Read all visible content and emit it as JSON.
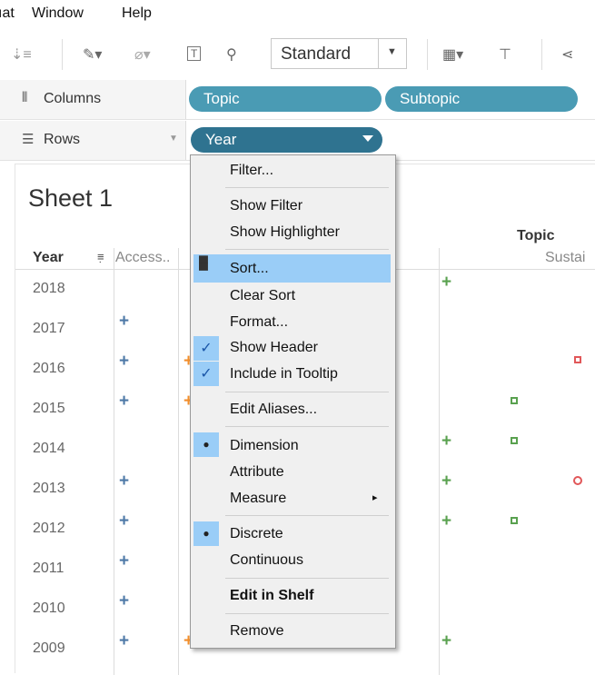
{
  "menubar": {
    "items": [
      "ıat",
      "Window",
      "Help"
    ]
  },
  "toolbar": {
    "view_mode": "Standard"
  },
  "shelves": {
    "columns": {
      "label": "Columns",
      "pills": [
        "Topic",
        "Subtopic"
      ]
    },
    "rows": {
      "label": "Rows",
      "pills": [
        "Year"
      ]
    }
  },
  "sheet": {
    "title": "Sheet 1",
    "row_header": "Year",
    "col_header_1": "Access..",
    "topic_header": "Topic",
    "topic_sub": "Sustai",
    "years": [
      "2018",
      "2017",
      "2016",
      "2015",
      "2014",
      "2013",
      "2012",
      "2011",
      "2010",
      "2009"
    ]
  },
  "context_menu": {
    "items": {
      "filter": "Filter...",
      "show_filter": "Show Filter",
      "show_highlighter": "Show Highlighter",
      "sort": "Sort...",
      "clear_sort": "Clear Sort",
      "format": "Format...",
      "show_header": "Show Header",
      "include_tooltip": "Include in Tooltip",
      "edit_aliases": "Edit Aliases...",
      "dimension": "Dimension",
      "attribute": "Attribute",
      "measure": "Measure",
      "discrete": "Discrete",
      "continuous": "Continuous",
      "edit_in_shelf": "Edit in Shelf",
      "remove": "Remove"
    },
    "checked": [
      "Show Header",
      "Include in Tooltip"
    ],
    "selected_radio": [
      "Dimension",
      "Discrete"
    ],
    "highlighted": "Sort..."
  },
  "colors": {
    "pill": "#4a9bb4",
    "pill_active": "#2f7390",
    "blue_mark": "#4e79a7",
    "green_mark": "#59a14f",
    "red_mark": "#e15759",
    "orange_mark": "#f28e2b",
    "menu_highlight": "#9acdf7"
  },
  "icons": [
    "sort-icon",
    "highlight-pen-icon",
    "paperclip-icon",
    "text-icon",
    "pin-icon",
    "show-me-icon",
    "presentation-icon",
    "share-icon",
    "columns-icon",
    "rows-icon",
    "dropdown-arrow-icon",
    "sort-indicator-icon",
    "checkmark-icon",
    "radio-dot-icon",
    "submenu-arrow-icon"
  ]
}
